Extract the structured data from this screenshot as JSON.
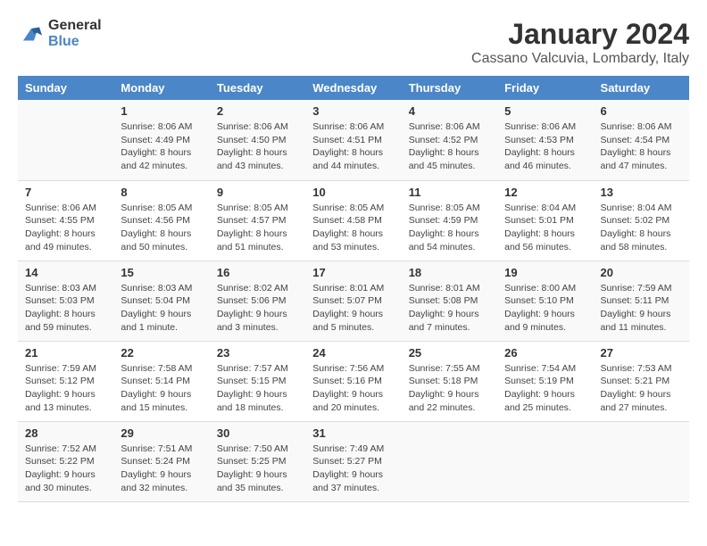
{
  "logo": {
    "line1": "General",
    "line2": "Blue"
  },
  "title": "January 2024",
  "subtitle": "Cassano Valcuvia, Lombardy, Italy",
  "days_of_week": [
    "Sunday",
    "Monday",
    "Tuesday",
    "Wednesday",
    "Thursday",
    "Friday",
    "Saturday"
  ],
  "weeks": [
    [
      {
        "day": "",
        "info": ""
      },
      {
        "day": "1",
        "info": "Sunrise: 8:06 AM\nSunset: 4:49 PM\nDaylight: 8 hours\nand 42 minutes."
      },
      {
        "day": "2",
        "info": "Sunrise: 8:06 AM\nSunset: 4:50 PM\nDaylight: 8 hours\nand 43 minutes."
      },
      {
        "day": "3",
        "info": "Sunrise: 8:06 AM\nSunset: 4:51 PM\nDaylight: 8 hours\nand 44 minutes."
      },
      {
        "day": "4",
        "info": "Sunrise: 8:06 AM\nSunset: 4:52 PM\nDaylight: 8 hours\nand 45 minutes."
      },
      {
        "day": "5",
        "info": "Sunrise: 8:06 AM\nSunset: 4:53 PM\nDaylight: 8 hours\nand 46 minutes."
      },
      {
        "day": "6",
        "info": "Sunrise: 8:06 AM\nSunset: 4:54 PM\nDaylight: 8 hours\nand 47 minutes."
      }
    ],
    [
      {
        "day": "7",
        "info": "Sunrise: 8:06 AM\nSunset: 4:55 PM\nDaylight: 8 hours\nand 49 minutes."
      },
      {
        "day": "8",
        "info": "Sunrise: 8:05 AM\nSunset: 4:56 PM\nDaylight: 8 hours\nand 50 minutes."
      },
      {
        "day": "9",
        "info": "Sunrise: 8:05 AM\nSunset: 4:57 PM\nDaylight: 8 hours\nand 51 minutes."
      },
      {
        "day": "10",
        "info": "Sunrise: 8:05 AM\nSunset: 4:58 PM\nDaylight: 8 hours\nand 53 minutes."
      },
      {
        "day": "11",
        "info": "Sunrise: 8:05 AM\nSunset: 4:59 PM\nDaylight: 8 hours\nand 54 minutes."
      },
      {
        "day": "12",
        "info": "Sunrise: 8:04 AM\nSunset: 5:01 PM\nDaylight: 8 hours\nand 56 minutes."
      },
      {
        "day": "13",
        "info": "Sunrise: 8:04 AM\nSunset: 5:02 PM\nDaylight: 8 hours\nand 58 minutes."
      }
    ],
    [
      {
        "day": "14",
        "info": "Sunrise: 8:03 AM\nSunset: 5:03 PM\nDaylight: 8 hours\nand 59 minutes."
      },
      {
        "day": "15",
        "info": "Sunrise: 8:03 AM\nSunset: 5:04 PM\nDaylight: 9 hours\nand 1 minute."
      },
      {
        "day": "16",
        "info": "Sunrise: 8:02 AM\nSunset: 5:06 PM\nDaylight: 9 hours\nand 3 minutes."
      },
      {
        "day": "17",
        "info": "Sunrise: 8:01 AM\nSunset: 5:07 PM\nDaylight: 9 hours\nand 5 minutes."
      },
      {
        "day": "18",
        "info": "Sunrise: 8:01 AM\nSunset: 5:08 PM\nDaylight: 9 hours\nand 7 minutes."
      },
      {
        "day": "19",
        "info": "Sunrise: 8:00 AM\nSunset: 5:10 PM\nDaylight: 9 hours\nand 9 minutes."
      },
      {
        "day": "20",
        "info": "Sunrise: 7:59 AM\nSunset: 5:11 PM\nDaylight: 9 hours\nand 11 minutes."
      }
    ],
    [
      {
        "day": "21",
        "info": "Sunrise: 7:59 AM\nSunset: 5:12 PM\nDaylight: 9 hours\nand 13 minutes."
      },
      {
        "day": "22",
        "info": "Sunrise: 7:58 AM\nSunset: 5:14 PM\nDaylight: 9 hours\nand 15 minutes."
      },
      {
        "day": "23",
        "info": "Sunrise: 7:57 AM\nSunset: 5:15 PM\nDaylight: 9 hours\nand 18 minutes."
      },
      {
        "day": "24",
        "info": "Sunrise: 7:56 AM\nSunset: 5:16 PM\nDaylight: 9 hours\nand 20 minutes."
      },
      {
        "day": "25",
        "info": "Sunrise: 7:55 AM\nSunset: 5:18 PM\nDaylight: 9 hours\nand 22 minutes."
      },
      {
        "day": "26",
        "info": "Sunrise: 7:54 AM\nSunset: 5:19 PM\nDaylight: 9 hours\nand 25 minutes."
      },
      {
        "day": "27",
        "info": "Sunrise: 7:53 AM\nSunset: 5:21 PM\nDaylight: 9 hours\nand 27 minutes."
      }
    ],
    [
      {
        "day": "28",
        "info": "Sunrise: 7:52 AM\nSunset: 5:22 PM\nDaylight: 9 hours\nand 30 minutes."
      },
      {
        "day": "29",
        "info": "Sunrise: 7:51 AM\nSunset: 5:24 PM\nDaylight: 9 hours\nand 32 minutes."
      },
      {
        "day": "30",
        "info": "Sunrise: 7:50 AM\nSunset: 5:25 PM\nDaylight: 9 hours\nand 35 minutes."
      },
      {
        "day": "31",
        "info": "Sunrise: 7:49 AM\nSunset: 5:27 PM\nDaylight: 9 hours\nand 37 minutes."
      },
      {
        "day": "",
        "info": ""
      },
      {
        "day": "",
        "info": ""
      },
      {
        "day": "",
        "info": ""
      }
    ]
  ]
}
